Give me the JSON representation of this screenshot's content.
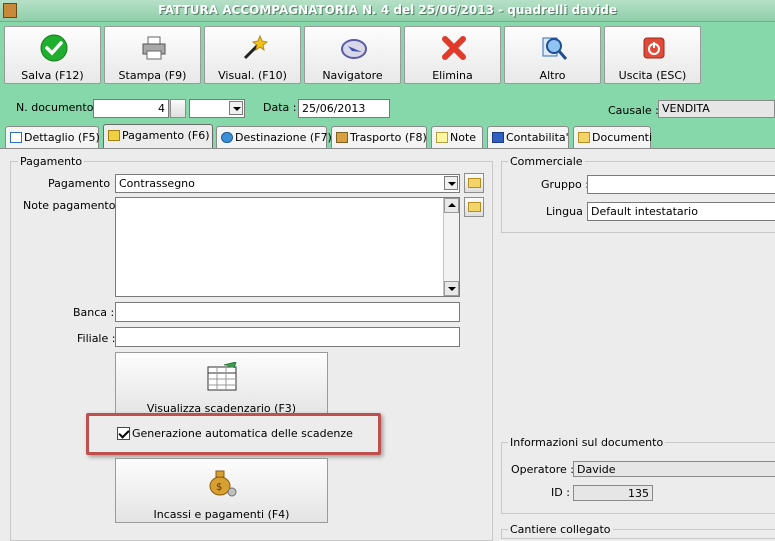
{
  "window": {
    "title": "FATTURA ACCOMPAGNATORIA N. 4 del 25/06/2013 - quadrelli davide"
  },
  "toolbar": {
    "buttons": [
      {
        "label": "Salva (F12)",
        "icon": "checkmark-icon",
        "color": "#1fae2d"
      },
      {
        "label": "Stampa (F9)",
        "icon": "printer-icon",
        "color": "#8c8c8c"
      },
      {
        "label": "Visual. (F10)",
        "icon": "magic-wand-icon",
        "color": "#e0b020"
      },
      {
        "label": "Navigatore",
        "icon": "compass-icon",
        "color": "#5a5aa8"
      },
      {
        "label": "Elimina",
        "icon": "delete-x-icon",
        "color": "#e03a2a"
      },
      {
        "label": "Altro",
        "icon": "search-magnifier-icon",
        "color": "#2f6fc0"
      },
      {
        "label": "Uscita (ESC)",
        "icon": "power-icon",
        "color": "#e04a3a"
      }
    ]
  },
  "header": {
    "doc_number_label": "N. documento :",
    "doc_number_value": "4",
    "date_label": "Data :",
    "date_value": "25/06/2013",
    "causale_label": "Causale :",
    "causale_value": "VENDITA"
  },
  "tabs": [
    {
      "label": "Dettaglio (F5)",
      "icon": "table-icon",
      "active": false
    },
    {
      "label": "Pagamento (F6)",
      "icon": "payment-icon",
      "active": true
    },
    {
      "label": "Destinazione (F7)",
      "icon": "globe-icon",
      "active": false
    },
    {
      "label": "Trasporto (F8)",
      "icon": "truck-icon",
      "active": false
    },
    {
      "label": "Note",
      "icon": "note-icon",
      "active": false
    },
    {
      "label": "Contabilita'",
      "icon": "book-icon",
      "active": false
    },
    {
      "label": "Documenti",
      "icon": "folder-icon",
      "active": false
    }
  ],
  "pagamento": {
    "group_title": "Pagamento",
    "pagamento_label": "Pagamento :",
    "pagamento_value": "Contrassegno",
    "note_label": "Note pagamento :",
    "banca_label": "Banca :",
    "banca_value": "",
    "filiale_label": "Filiale :",
    "filiale_value": "",
    "scadenzario_button": "Visualizza scadenzario (F3)",
    "auto_scadenze_label": "Generazione automatica delle scadenze",
    "auto_scadenze_checked": true,
    "incassi_button": "Incassi e pagamenti (F4)"
  },
  "commerciale": {
    "group_title": "Commerciale",
    "gruppo_label": "Gruppo :",
    "gruppo_value": "",
    "lingua_label": "Lingua :",
    "lingua_value": "Default intestatario"
  },
  "info": {
    "group_title": "Informazioni sul documento",
    "operatore_label": "Operatore :",
    "operatore_value": "Davide",
    "id_label": "ID :",
    "id_value": "135"
  },
  "cantiere": {
    "group_title": "Cantiere collegato"
  },
  "colors": {
    "toolbar_bg": "#86d7a9",
    "highlight_border": "#c0504d"
  }
}
